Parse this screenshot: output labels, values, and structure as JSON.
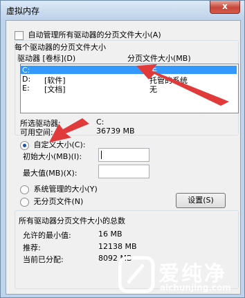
{
  "window": {
    "title": "虚拟内存",
    "close_label": "x"
  },
  "auto_manage": {
    "label": "自动管理所有驱动器的分页文件大小(A)",
    "checked": false
  },
  "per_drive_group": {
    "title": "每个驱动器的分页文件大小",
    "col_drive": "驱动器 [卷标](D)",
    "col_size": "分页文件大小(MB)",
    "rows": [
      {
        "drive": "C:",
        "label": "",
        "size": "无",
        "selected": true
      },
      {
        "drive": "D:",
        "label": "[软件]",
        "size": "托管的系统",
        "selected": false
      },
      {
        "drive": "E:",
        "label": "[文档]",
        "size": "无",
        "selected": false
      }
    ]
  },
  "selected_drive": {
    "label": "所选驱动器:",
    "value": "C:"
  },
  "free_space": {
    "label": "可用空间:",
    "value": "36739 MB"
  },
  "custom_size": {
    "label": "自定义大小(C):",
    "selected": true
  },
  "initial_size": {
    "label": "初始大小(MB)(I):",
    "value": ""
  },
  "max_size": {
    "label": "最大值(MB)(X):",
    "value": ""
  },
  "system_managed": {
    "label": "系统管理的大小(Y)",
    "selected": false
  },
  "no_paging": {
    "label": "无分页文件(N)",
    "selected": false
  },
  "set_button": {
    "label": "设置(S)"
  },
  "total_group": {
    "title": "所有驱动器分页文件大小的总数",
    "min_label": "允许的最小值:",
    "min_value": "16 MB",
    "recommended_label": "推荐:",
    "recommended_value": "12138 MB",
    "current_label": "当前已分配:",
    "current_value": "8092 MB"
  },
  "watermark": {
    "brand": "爱纯净",
    "url": "aichunjing.com"
  },
  "colors": {
    "selection": "#3399ff",
    "arrow": "#e03a3a"
  }
}
